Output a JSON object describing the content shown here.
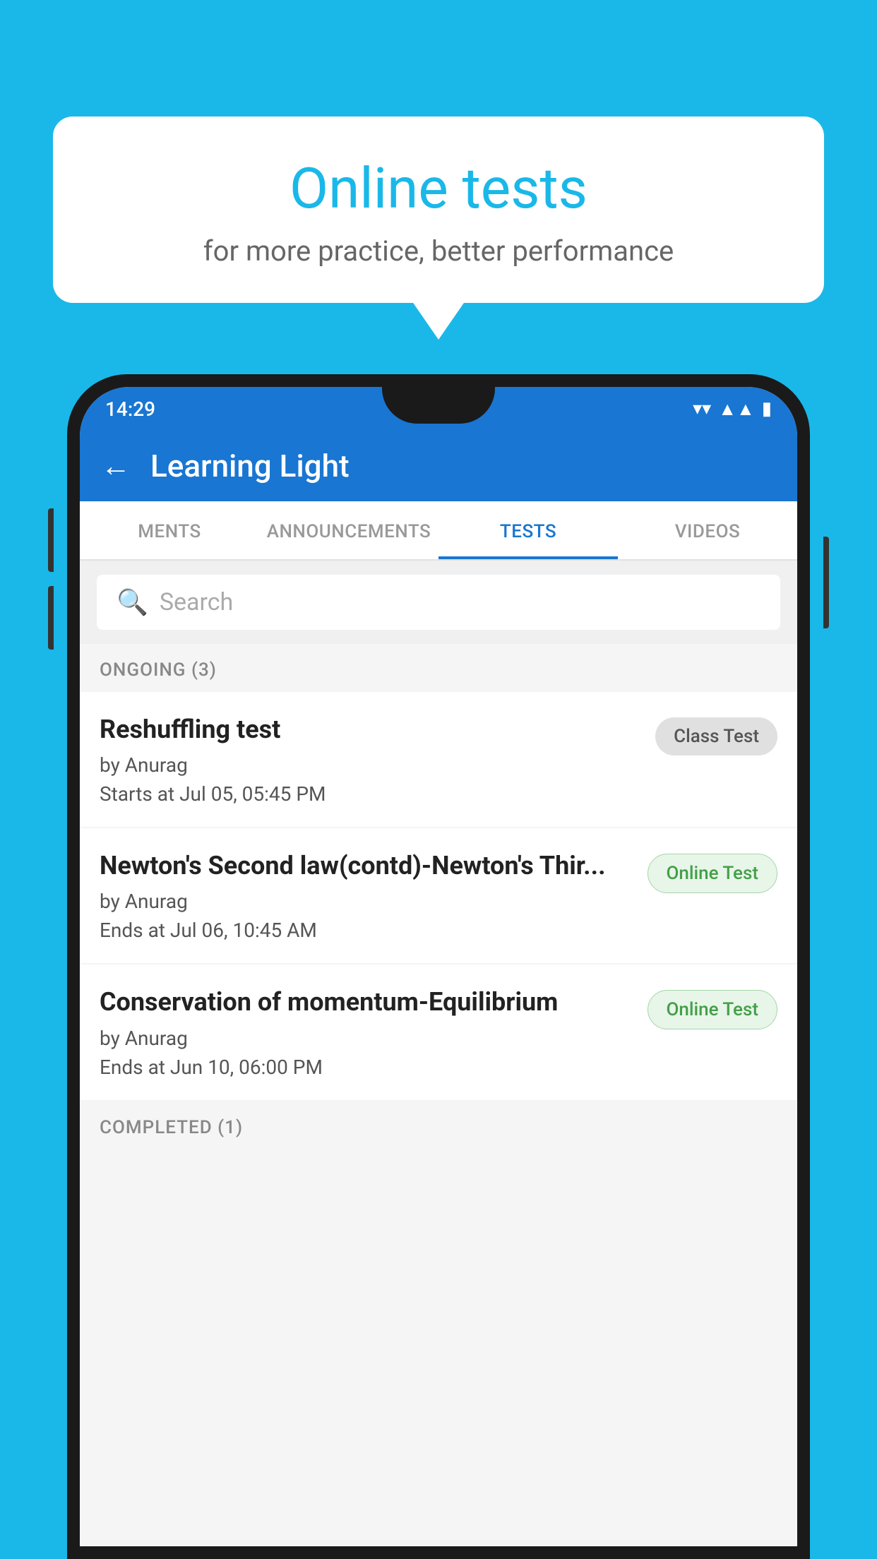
{
  "background": {
    "color": "#1ab8e8"
  },
  "speech_bubble": {
    "title": "Online tests",
    "subtitle": "for more practice, better performance"
  },
  "phone": {
    "status_bar": {
      "time": "14:29",
      "wifi": "▼",
      "signal": "▲",
      "battery": "▮"
    },
    "app_bar": {
      "back_label": "←",
      "title": "Learning Light"
    },
    "tabs": [
      {
        "label": "MENTS",
        "active": false
      },
      {
        "label": "ANNOUNCEMENTS",
        "active": false
      },
      {
        "label": "TESTS",
        "active": true
      },
      {
        "label": "VIDEOS",
        "active": false
      }
    ],
    "search": {
      "placeholder": "Search"
    },
    "sections": [
      {
        "header": "ONGOING (3)",
        "tests": [
          {
            "title": "Reshuffling test",
            "author": "by Anurag",
            "date": "Starts at  Jul 05, 05:45 PM",
            "badge": "Class Test",
            "badge_type": "class"
          },
          {
            "title": "Newton's Second law(contd)-Newton's Thir...",
            "author": "by Anurag",
            "date": "Ends at  Jul 06, 10:45 AM",
            "badge": "Online Test",
            "badge_type": "online"
          },
          {
            "title": "Conservation of momentum-Equilibrium",
            "author": "by Anurag",
            "date": "Ends at  Jun 10, 06:00 PM",
            "badge": "Online Test",
            "badge_type": "online"
          }
        ]
      },
      {
        "header": "COMPLETED (1)",
        "tests": []
      }
    ]
  }
}
